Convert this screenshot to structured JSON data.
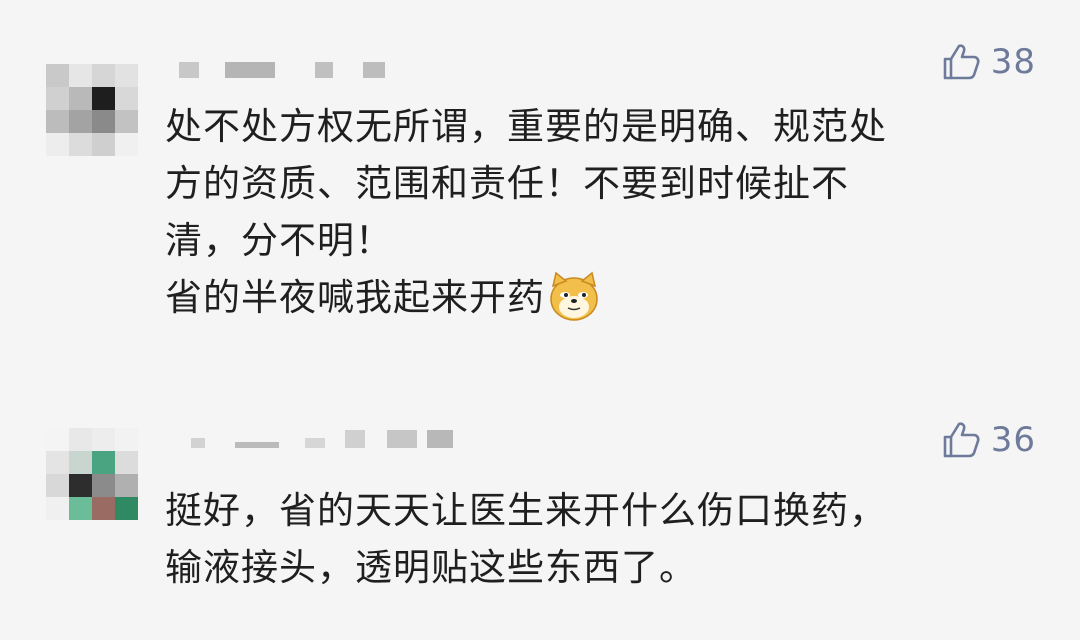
{
  "comments": [
    {
      "likes": "38",
      "lines": [
        "处不处方权无所谓，重要的是明确、规范处",
        "方的资质、范围和责任！不要到时候扯不",
        "清，分不明！",
        "省的半夜喊我起来开药"
      ],
      "emoji": "doge-emoji"
    },
    {
      "likes": "36",
      "lines": [
        "挺好，省的天天让医生来开什么伤口换药，",
        "输液接头，透明贴这些东西了。"
      ]
    }
  ],
  "colors": {
    "background": "#f5f5f5",
    "text": "#1f1f1f",
    "like": "#6d7a99"
  },
  "icons": {
    "like": "thumbs-up-icon",
    "avatar": "pixelated-avatar",
    "emoji": "doge-emoji"
  }
}
